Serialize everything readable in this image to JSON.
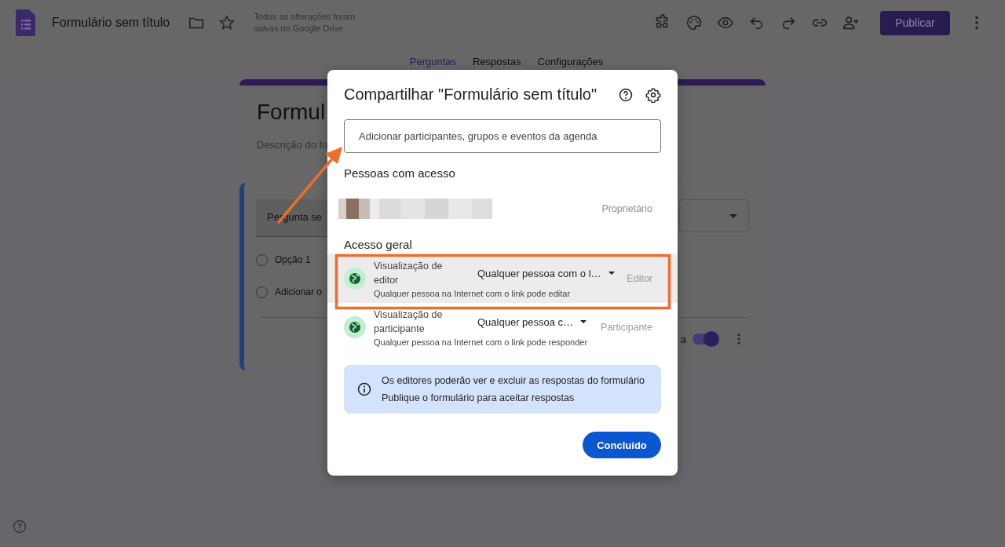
{
  "header": {
    "title": "Formulário sem título",
    "save_status": "Todas as alterações foram salvas no Google Drive",
    "publish_button": "Publicar"
  },
  "tabs": [
    {
      "label": "Perguntas",
      "selected": true
    },
    {
      "label": "Respostas",
      "selected": false
    },
    {
      "label": "Configurações",
      "selected": false
    }
  ],
  "form_background": {
    "title_fragment": "Formul",
    "description_fragment": "Descrição do fo",
    "question_fragment": "Pergunta se",
    "options": [
      {
        "label": "Opção 1",
        "checked": false
      },
      {
        "label": "Adicionar o",
        "checked": false
      }
    ],
    "required_fragment": "a",
    "required_on": true
  },
  "dialog": {
    "title": "Compartilhar \"Formulário sem título\"",
    "add_field": {
      "placeholder": "Adicionar participantes, grupos e eventos da agenda"
    },
    "people_heading": "Pessoas com acesso",
    "people": [
      {
        "role": "Proprietário"
      }
    ],
    "general_access_heading": "Acesso geral",
    "access_rows": [
      {
        "title": "Visualização de editor",
        "audience": "Qualquer pessoa com o l…",
        "description": "Qualquer pessoa na Internet com o link pode editar",
        "role": "Editor",
        "highlighted": true
      },
      {
        "title": "Visualização de participante",
        "audience": "Qualquer pessoa c…",
        "description": "Qualquer pessoa na Internet com o link pode responder",
        "role": "Participante",
        "highlighted": false
      }
    ],
    "info": [
      "Os editores poderão ver e excluir as respostas do formulário",
      "Publique o formulário para aceitar respostas"
    ],
    "done_button": "Concluído"
  },
  "annotations": [
    {
      "kind": "arrow"
    },
    {
      "kind": "frame"
    }
  ]
}
